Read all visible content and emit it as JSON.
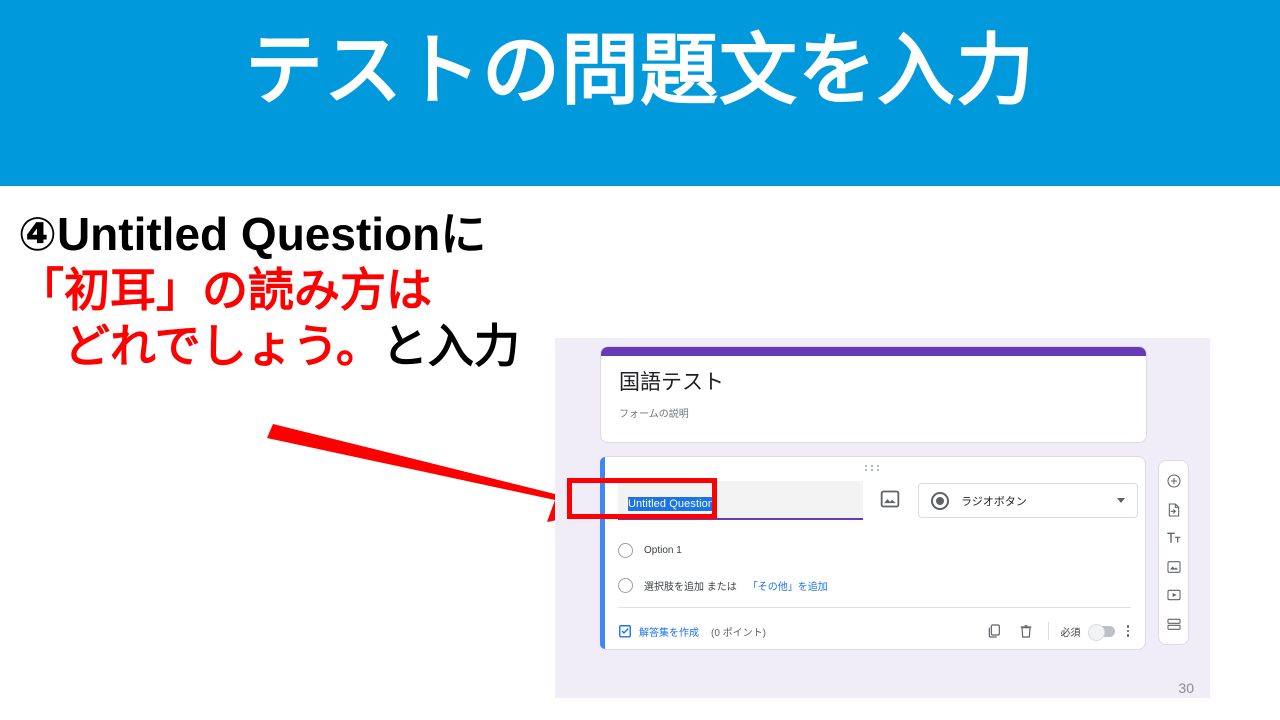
{
  "slide": {
    "banner_title": "テストの問題文を入力",
    "banner_color": "#0099DC",
    "page_number": "30"
  },
  "instructions": {
    "line1": "④Untitled Questionに",
    "line2": "「初耳」の読み方は",
    "line3_red": "どれでしょう。",
    "line3_black": "と入力",
    "red_color": "#FF0000",
    "black_color": "#000000"
  },
  "forms": {
    "header_card": {
      "title": "国語テスト",
      "description": "フォームの説明",
      "accent_color": "#673AB7"
    },
    "question_card": {
      "title_value": "Untitled Question",
      "type_label": "ラジオボタン",
      "type_icon": "radio-button-icon",
      "image_icon": "insert-image-icon",
      "drag_handle_icon": "drag-handle-icon",
      "options": [
        {
          "label": "Option 1",
          "link": ""
        },
        {
          "label": "選択肢を追加 または ",
          "link": "「その他」を追加"
        }
      ],
      "footer": {
        "answer_key_label": "解答集を作成",
        "answer_key_icon": "answer-key-clipboard-icon",
        "points": "(0 ポイント)",
        "duplicate_icon": "duplicate-icon",
        "delete_icon": "trash-icon",
        "required_label": "必須",
        "toggle_state": "off",
        "more_icon": "more-vertical-icon"
      },
      "accent_color": "#4285F4",
      "selection_color": "#1a73e8",
      "highlight_box_color": "#FF0000"
    },
    "side_toolbar": {
      "items": [
        {
          "icon": "add-question-icon"
        },
        {
          "icon": "import-questions-icon"
        },
        {
          "icon": "add-title-description-icon"
        },
        {
          "icon": "add-image-icon"
        },
        {
          "icon": "add-video-icon"
        },
        {
          "icon": "add-section-icon"
        }
      ]
    }
  },
  "annotation": {
    "arrow_icon": "red-arrow-icon",
    "arrow_color": "#FF0000"
  }
}
